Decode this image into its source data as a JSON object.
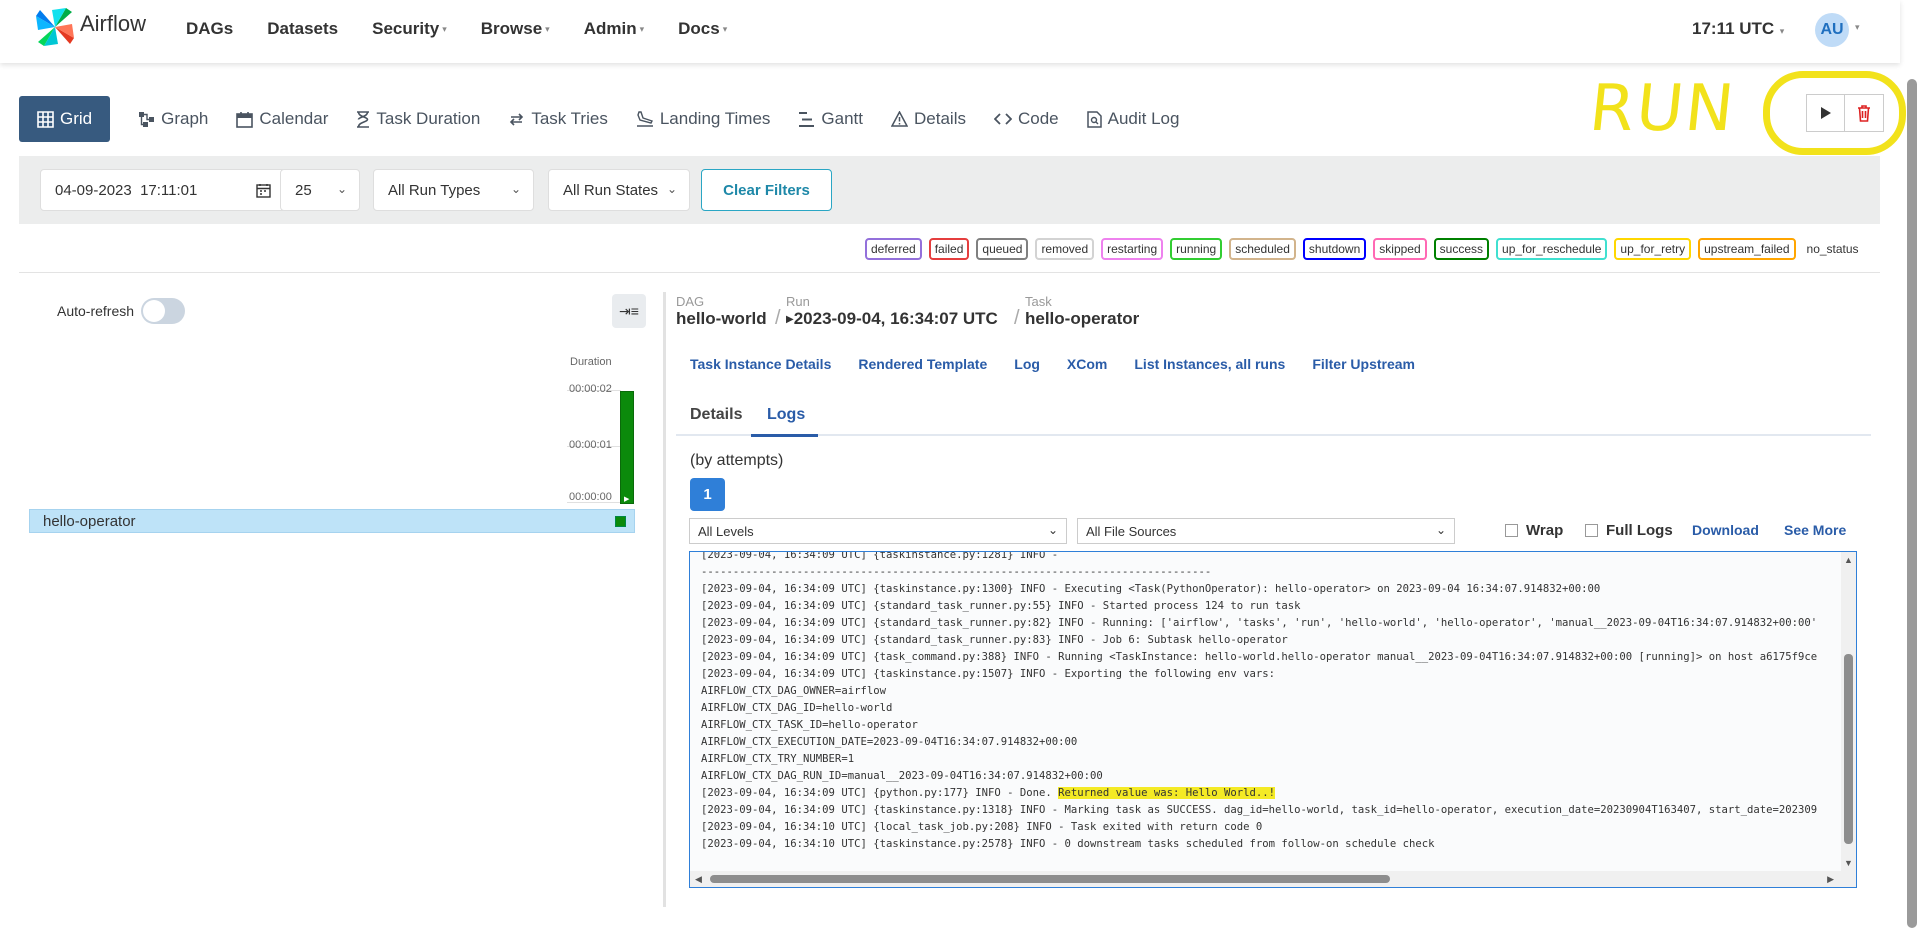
{
  "app": {
    "name": "Airflow",
    "clock": "17:11 UTC",
    "user_initials": "AU"
  },
  "nav": [
    {
      "label": "DAGs",
      "dropdown": false
    },
    {
      "label": "Datasets",
      "dropdown": false
    },
    {
      "label": "Security",
      "dropdown": true
    },
    {
      "label": "Browse",
      "dropdown": true
    },
    {
      "label": "Admin",
      "dropdown": true
    },
    {
      "label": "Docs",
      "dropdown": true
    }
  ],
  "view_tabs": [
    {
      "label": "Grid",
      "icon": "grid-icon",
      "active": true
    },
    {
      "label": "Graph",
      "icon": "graph-icon"
    },
    {
      "label": "Calendar",
      "icon": "calendar-icon"
    },
    {
      "label": "Task Duration",
      "icon": "hourglass-icon"
    },
    {
      "label": "Task Tries",
      "icon": "retry-icon"
    },
    {
      "label": "Landing Times",
      "icon": "landing-icon"
    },
    {
      "label": "Gantt",
      "icon": "gantt-icon"
    },
    {
      "label": "Details",
      "icon": "warning-icon"
    },
    {
      "label": "Code",
      "icon": "code-icon"
    },
    {
      "label": "Audit Log",
      "icon": "audit-icon"
    }
  ],
  "annotation": {
    "text": "RUN"
  },
  "filters": {
    "date": "04-09-2023  17:11:01",
    "num_runs": "25",
    "run_type": "All Run Types",
    "run_state": "All Run States",
    "clear_label": "Clear Filters"
  },
  "legend": [
    {
      "label": "deferred",
      "color": "#9370db"
    },
    {
      "label": "failed",
      "color": "#e53e3e"
    },
    {
      "label": "queued",
      "color": "#808080"
    },
    {
      "label": "removed",
      "color": "#d3d3d3"
    },
    {
      "label": "restarting",
      "color": "#ee82ee"
    },
    {
      "label": "running",
      "color": "#32cd32"
    },
    {
      "label": "scheduled",
      "color": "#d2b48c"
    },
    {
      "label": "shutdown",
      "color": "#0000ff"
    },
    {
      "label": "skipped",
      "color": "#ff69b4"
    },
    {
      "label": "success",
      "color": "#008000"
    },
    {
      "label": "up_for_reschedule",
      "color": "#40e0d0"
    },
    {
      "label": "up_for_retry",
      "color": "#ffd700"
    },
    {
      "label": "upstream_failed",
      "color": "#ffa500"
    }
  ],
  "legend_plain": "no_status",
  "grid": {
    "auto_refresh_label": "Auto-refresh",
    "duration_label": "Duration",
    "duration_ticks": [
      "00:00:02",
      "00:00:01",
      "00:00:00"
    ],
    "task_name": "hello-operator"
  },
  "breadcrumb": {
    "dag_label": "DAG",
    "dag_value": "hello-world",
    "run_label": "Run",
    "run_value": "2023-09-04, 16:34:07 UTC",
    "task_label": "Task",
    "task_value": "hello-operator"
  },
  "task_tabs": [
    "Task Instance Details",
    "Rendered Template",
    "Log",
    "XCom",
    "List Instances, all runs",
    "Filter Upstream"
  ],
  "detail_tabs": {
    "details": "Details",
    "logs": "Logs"
  },
  "logs": {
    "attempts_label": "(by attempts)",
    "attempt": "1",
    "level_select": "All Levels",
    "source_select": "All File Sources",
    "wrap_label": "Wrap",
    "full_logs_label": "Full Logs",
    "download_label": "Download",
    "see_more_label": "See More",
    "lines": [
      "[2023-09-04, 16:34:09 UTC] {taskinstance.py:1281} INFO -",
      "--------------------------------------------------------------------------------",
      "[2023-09-04, 16:34:09 UTC] {taskinstance.py:1300} INFO - Executing <Task(PythonOperator): hello-operator> on 2023-09-04 16:34:07.914832+00:00",
      "[2023-09-04, 16:34:09 UTC] {standard_task_runner.py:55} INFO - Started process 124 to run task",
      "[2023-09-04, 16:34:09 UTC] {standard_task_runner.py:82} INFO - Running: ['airflow', 'tasks', 'run', 'hello-world', 'hello-operator', 'manual__2023-09-04T16:34:07.914832+00:00'",
      "[2023-09-04, 16:34:09 UTC] {standard_task_runner.py:83} INFO - Job 6: Subtask hello-operator",
      "[2023-09-04, 16:34:09 UTC] {task_command.py:388} INFO - Running <TaskInstance: hello-world.hello-operator manual__2023-09-04T16:34:07.914832+00:00 [running]> on host a6175f9ce",
      "[2023-09-04, 16:34:09 UTC] {taskinstance.py:1507} INFO - Exporting the following env vars:",
      "AIRFLOW_CTX_DAG_OWNER=airflow",
      "AIRFLOW_CTX_DAG_ID=hello-world",
      "AIRFLOW_CTX_TASK_ID=hello-operator",
      "AIRFLOW_CTX_EXECUTION_DATE=2023-09-04T16:34:07.914832+00:00",
      "AIRFLOW_CTX_TRY_NUMBER=1",
      "AIRFLOW_CTX_DAG_RUN_ID=manual__2023-09-04T16:34:07.914832+00:00",
      "[2023-09-04, 16:34:09 UTC] {python.py:177} INFO - Done. Returned value was: Hello World..!",
      "[2023-09-04, 16:34:09 UTC] {taskinstance.py:1318} INFO - Marking task as SUCCESS. dag_id=hello-world, task_id=hello-operator, execution_date=20230904T163407, start_date=202309",
      "[2023-09-04, 16:34:10 UTC] {local_task_job.py:208} INFO - Task exited with return code 0",
      "[2023-09-04, 16:34:10 UTC] {taskinstance.py:2578} INFO - 0 downstream tasks scheduled from follow-on schedule check"
    ],
    "highlight_line": 14,
    "highlight_text": "Returned value was: Hello World..!"
  },
  "colors": {
    "accent": "#375a7f",
    "link": "#2a5ca8",
    "success": "#0b8a0b",
    "annotation": "#f2e21b"
  }
}
